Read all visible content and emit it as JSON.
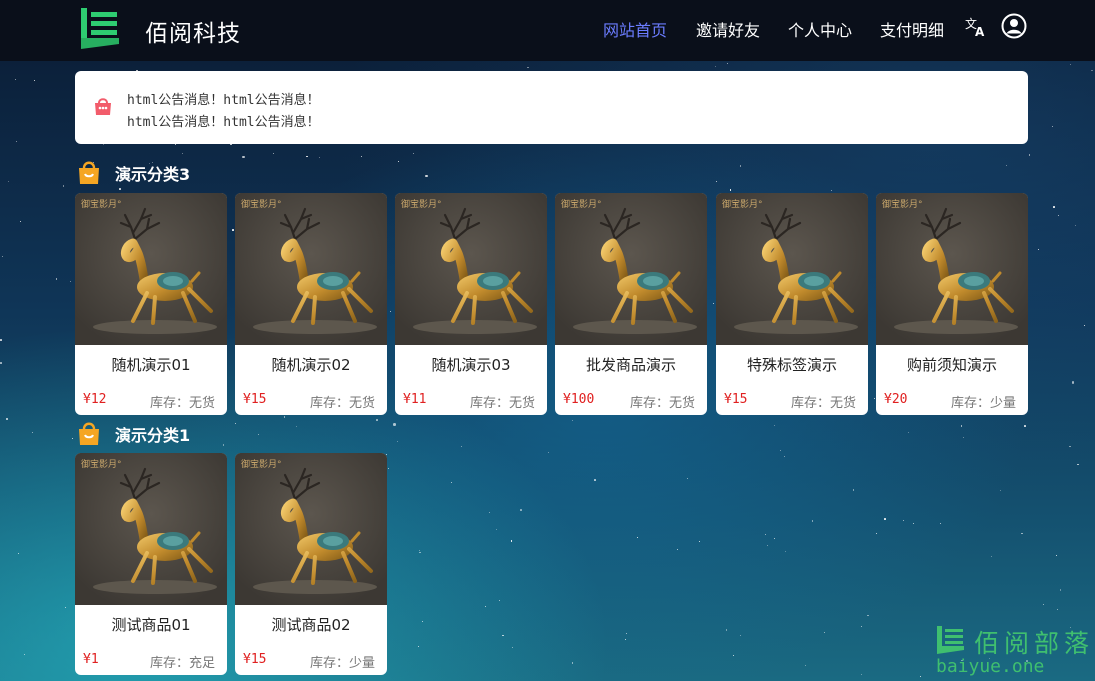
{
  "header": {
    "brand_name": "佰阅科技",
    "nav": [
      {
        "label": "网站首页",
        "active": true
      },
      {
        "label": "邀请好友",
        "active": false
      },
      {
        "label": "个人中心",
        "active": false
      },
      {
        "label": "支付明细",
        "active": false
      }
    ],
    "icons": [
      "translate-icon",
      "user-account-icon"
    ],
    "accent_color": "#6b7cff"
  },
  "notice": {
    "icon": "shop-bag-icon",
    "lines": [
      "html公告消息！html公告消息！",
      "html公告消息！html公告消息！"
    ]
  },
  "categories": [
    {
      "title": "演示分类3",
      "icon": "shopping-bag-icon",
      "products": [
        {
          "name": "随机演示01",
          "price": "¥12",
          "stock": "库存：无货"
        },
        {
          "name": "随机演示02",
          "price": "¥15",
          "stock": "库存：无货"
        },
        {
          "name": "随机演示03",
          "price": "¥11",
          "stock": "库存：无货"
        },
        {
          "name": "批发商品演示",
          "price": "¥100",
          "stock": "库存：无货"
        },
        {
          "name": "特殊标签演示",
          "price": "¥15",
          "stock": "库存：无货"
        },
        {
          "name": "购前须知演示",
          "price": "¥20",
          "stock": "库存：少量"
        }
      ]
    },
    {
      "title": "演示分类1",
      "icon": "shopping-bag-icon",
      "products": [
        {
          "name": "测试商品01",
          "price": "¥1",
          "stock": "库存：充足"
        },
        {
          "name": "测试商品02",
          "price": "¥15",
          "stock": "库存：少量"
        }
      ]
    }
  ],
  "product_image_label": "deer-sculpture-image",
  "watermark": {
    "text": "佰阅部落",
    "url": "baiyue.one",
    "color": "#3fbf6f"
  }
}
